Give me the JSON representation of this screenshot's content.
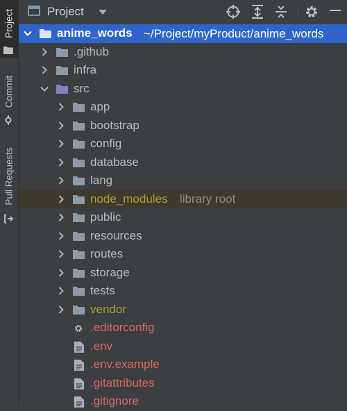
{
  "side_tabs": {
    "project": "Project",
    "commit": "Commit",
    "pull_requests": "Pull Requests"
  },
  "header": {
    "title": "Project",
    "icons": [
      "locate-icon",
      "expand-all-icon",
      "collapse-all-icon",
      "gear-icon"
    ]
  },
  "tree": {
    "root": {
      "name": "anime_words",
      "path": "~/Project/myProduct/anime_words"
    },
    "items": [
      {
        "label": ".github",
        "kind": "folder"
      },
      {
        "label": "infra",
        "kind": "folder"
      },
      {
        "label": "src",
        "kind": "source-folder",
        "expanded": true
      },
      {
        "label": "app",
        "kind": "folder"
      },
      {
        "label": "bootstrap",
        "kind": "folder"
      },
      {
        "label": "config",
        "kind": "folder"
      },
      {
        "label": "database",
        "kind": "folder"
      },
      {
        "label": "lang",
        "kind": "folder"
      },
      {
        "label": "node_modules",
        "kind": "library-folder",
        "hint": "library root"
      },
      {
        "label": "public",
        "kind": "folder"
      },
      {
        "label": "resources",
        "kind": "folder"
      },
      {
        "label": "routes",
        "kind": "folder"
      },
      {
        "label": "storage",
        "kind": "folder"
      },
      {
        "label": "tests",
        "kind": "folder"
      },
      {
        "label": "vendor",
        "kind": "library-folder"
      },
      {
        "label": ".editorconfig",
        "kind": "config-file"
      },
      {
        "label": ".env",
        "kind": "file"
      },
      {
        "label": ".env.example",
        "kind": "file"
      },
      {
        "label": ".gitattributes",
        "kind": "file"
      },
      {
        "label": ".gitignore",
        "kind": "file"
      }
    ]
  },
  "colors": {
    "background": "#3c3f41",
    "selection": "#2f65ca",
    "library_row": "#3e3a2d",
    "library_text": "#a8a23a",
    "ignored_text": "#d76a5e",
    "folder": "#8d9aa8",
    "source_folder": "#8a7fc1"
  }
}
